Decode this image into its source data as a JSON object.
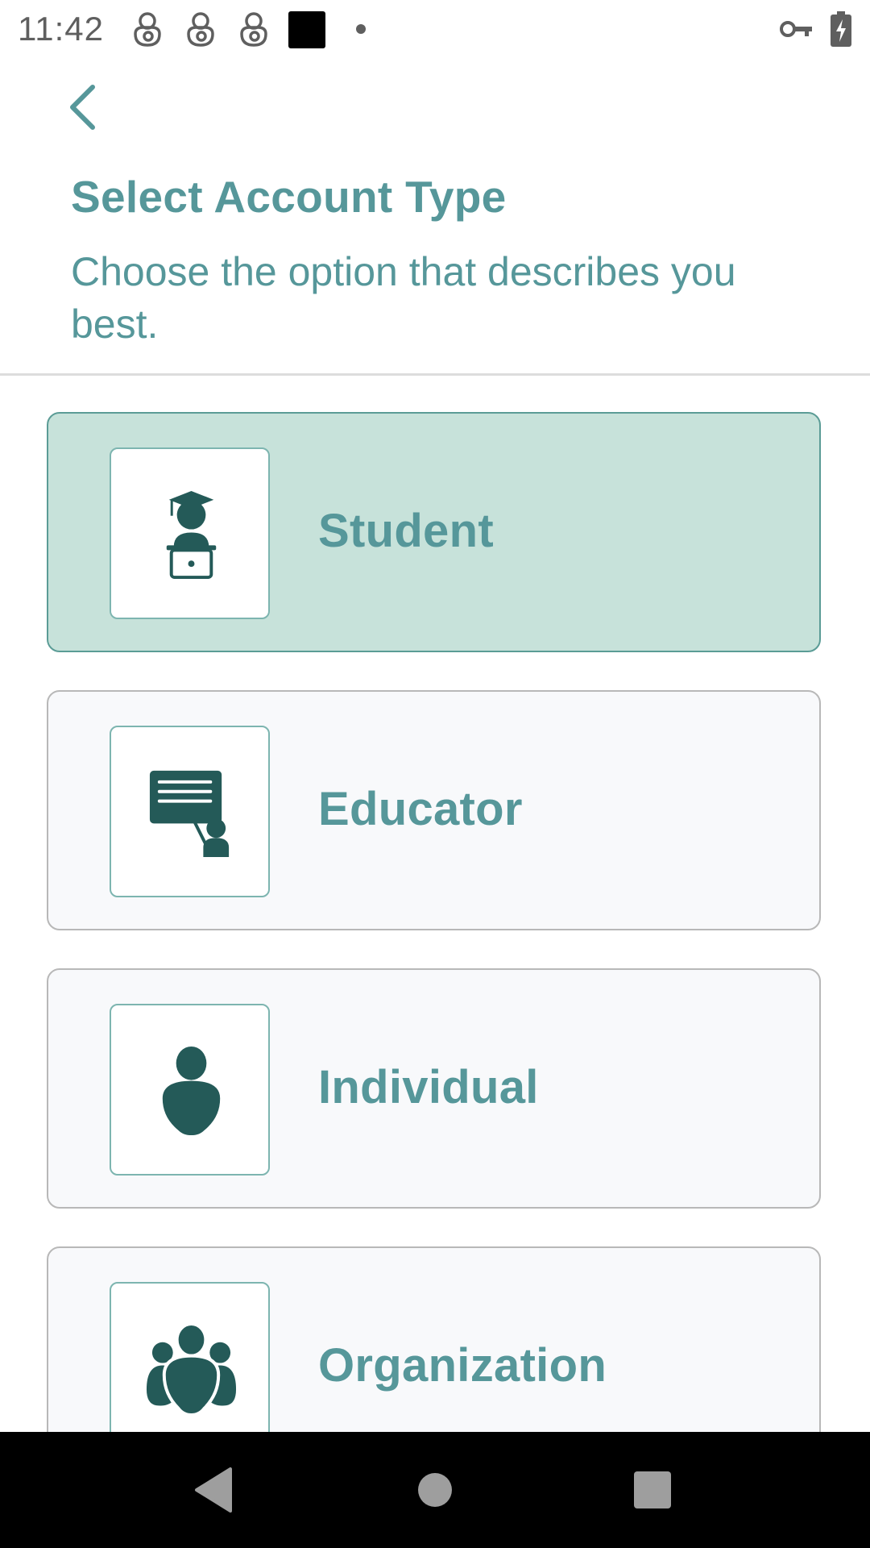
{
  "status_bar": {
    "time": "11:42",
    "icons": [
      "notification-app-icon",
      "notification-app-icon",
      "notification-app-icon",
      "black-square-icon",
      "dot-icon",
      "vpn-key-icon",
      "battery-charging-icon"
    ]
  },
  "header": {
    "back_icon": "chevron-left-icon",
    "title": "Select Account Type",
    "subtitle": "Choose the option that describes you best."
  },
  "options": [
    {
      "label": "Student",
      "icon": "student-graduate-laptop-icon",
      "selected": true
    },
    {
      "label": "Educator",
      "icon": "teacher-board-icon",
      "selected": false
    },
    {
      "label": "Individual",
      "icon": "person-icon",
      "selected": false
    },
    {
      "label": "Organization",
      "icon": "group-icon",
      "selected": false
    }
  ],
  "nav_bar": {
    "buttons": [
      "back-triangle-icon",
      "home-circle-icon",
      "recents-square-icon"
    ]
  },
  "colors": {
    "accent_text": "#56979a",
    "icon_dark": "#245a58",
    "selected_card_bg": "#c7e2da",
    "selected_card_border": "#5b9c96",
    "card_bg": "#f8f9fb",
    "card_border": "#b8b8b8"
  }
}
